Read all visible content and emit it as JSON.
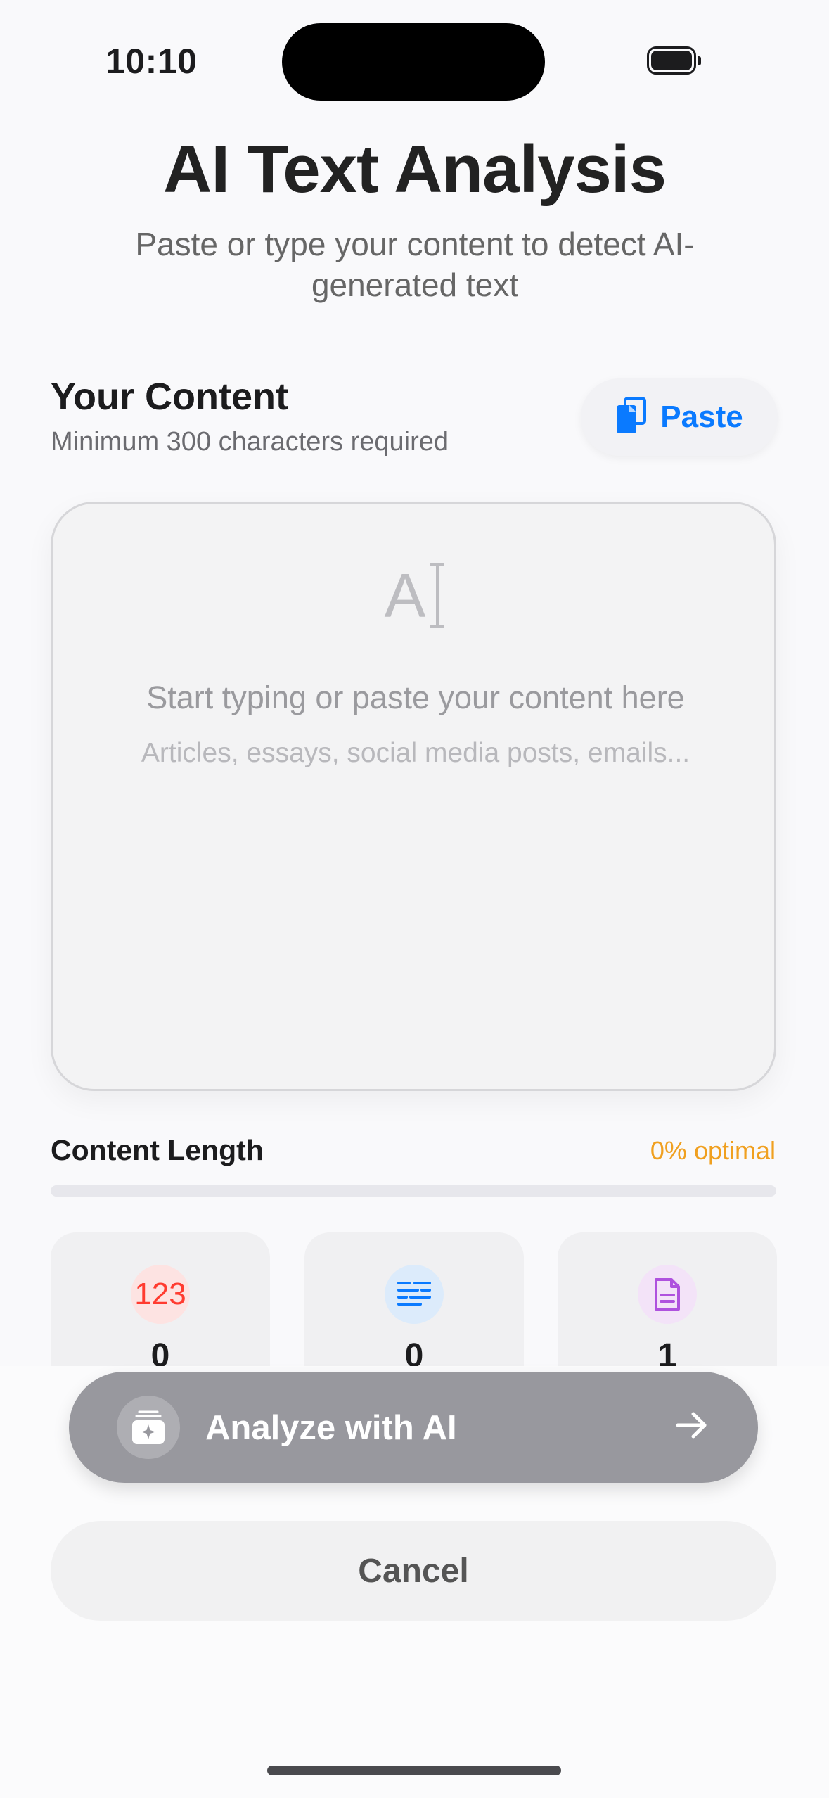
{
  "status_bar": {
    "time": "10:10"
  },
  "header": {
    "title": "AI Text Analysis",
    "subtitle": "Paste or type your content to detect AI-generated text"
  },
  "content_section": {
    "title": "Your Content",
    "hint": "Minimum 300 characters required",
    "paste_label": "Paste"
  },
  "editor": {
    "icon": "text-cursor-icon",
    "icon_text": "A",
    "placeholder": "Start typing or paste your content here",
    "sub_placeholder": "Articles, essays, social media posts, emails..."
  },
  "content_length": {
    "label": "Content Length",
    "value_text": "0% optimal",
    "progress": 0
  },
  "stats": [
    {
      "icon": "numbers-icon",
      "icon_text": "123",
      "value": "0",
      "color": "#ff3b30"
    },
    {
      "icon": "text-lines-icon",
      "value": "0",
      "color": "#0a7aff"
    },
    {
      "icon": "document-icon",
      "value": "1",
      "color": "#af52de"
    }
  ],
  "actions": {
    "analyze_label": "Analyze with AI",
    "cancel_label": "Cancel"
  },
  "colors": {
    "accent": "#0a7aff",
    "warning": "#f0a020",
    "disabled_button": "#98989e"
  }
}
